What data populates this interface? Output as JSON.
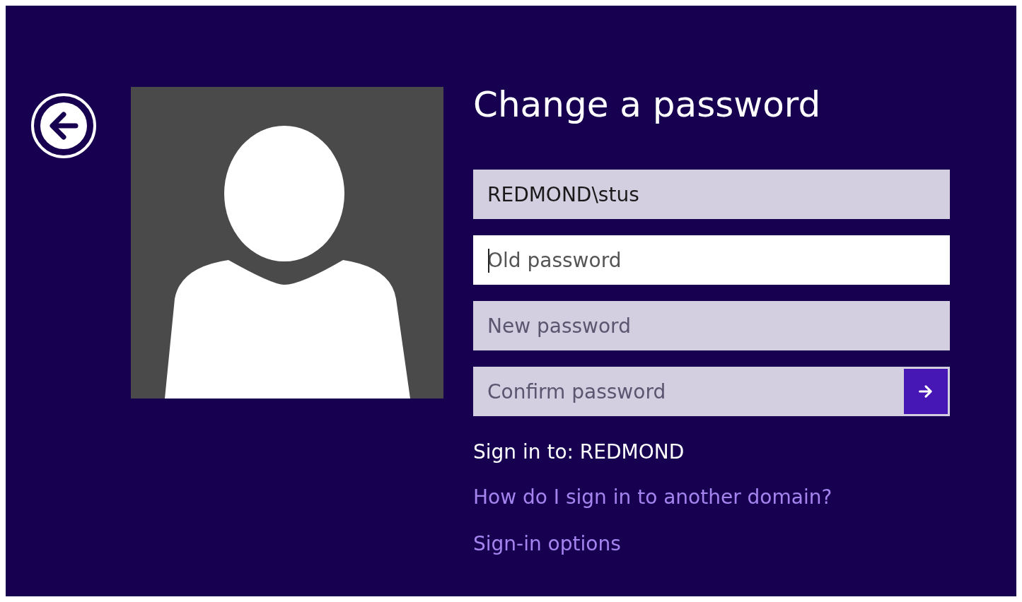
{
  "title": "Change a password",
  "fields": [
    {
      "kind": "text",
      "value": "REDMOND\\stus",
      "focused": false
    },
    {
      "kind": "text",
      "placeholder": "Old password",
      "focused": true
    },
    {
      "kind": "text",
      "placeholder": "New password",
      "focused": false
    },
    {
      "kind": "submit",
      "placeholder": "Confirm password",
      "focused": false
    }
  ],
  "sign_in_to": "Sign in to: REDMOND",
  "links": [
    "How do I sign in to another domain?",
    "Sign-in options"
  ]
}
